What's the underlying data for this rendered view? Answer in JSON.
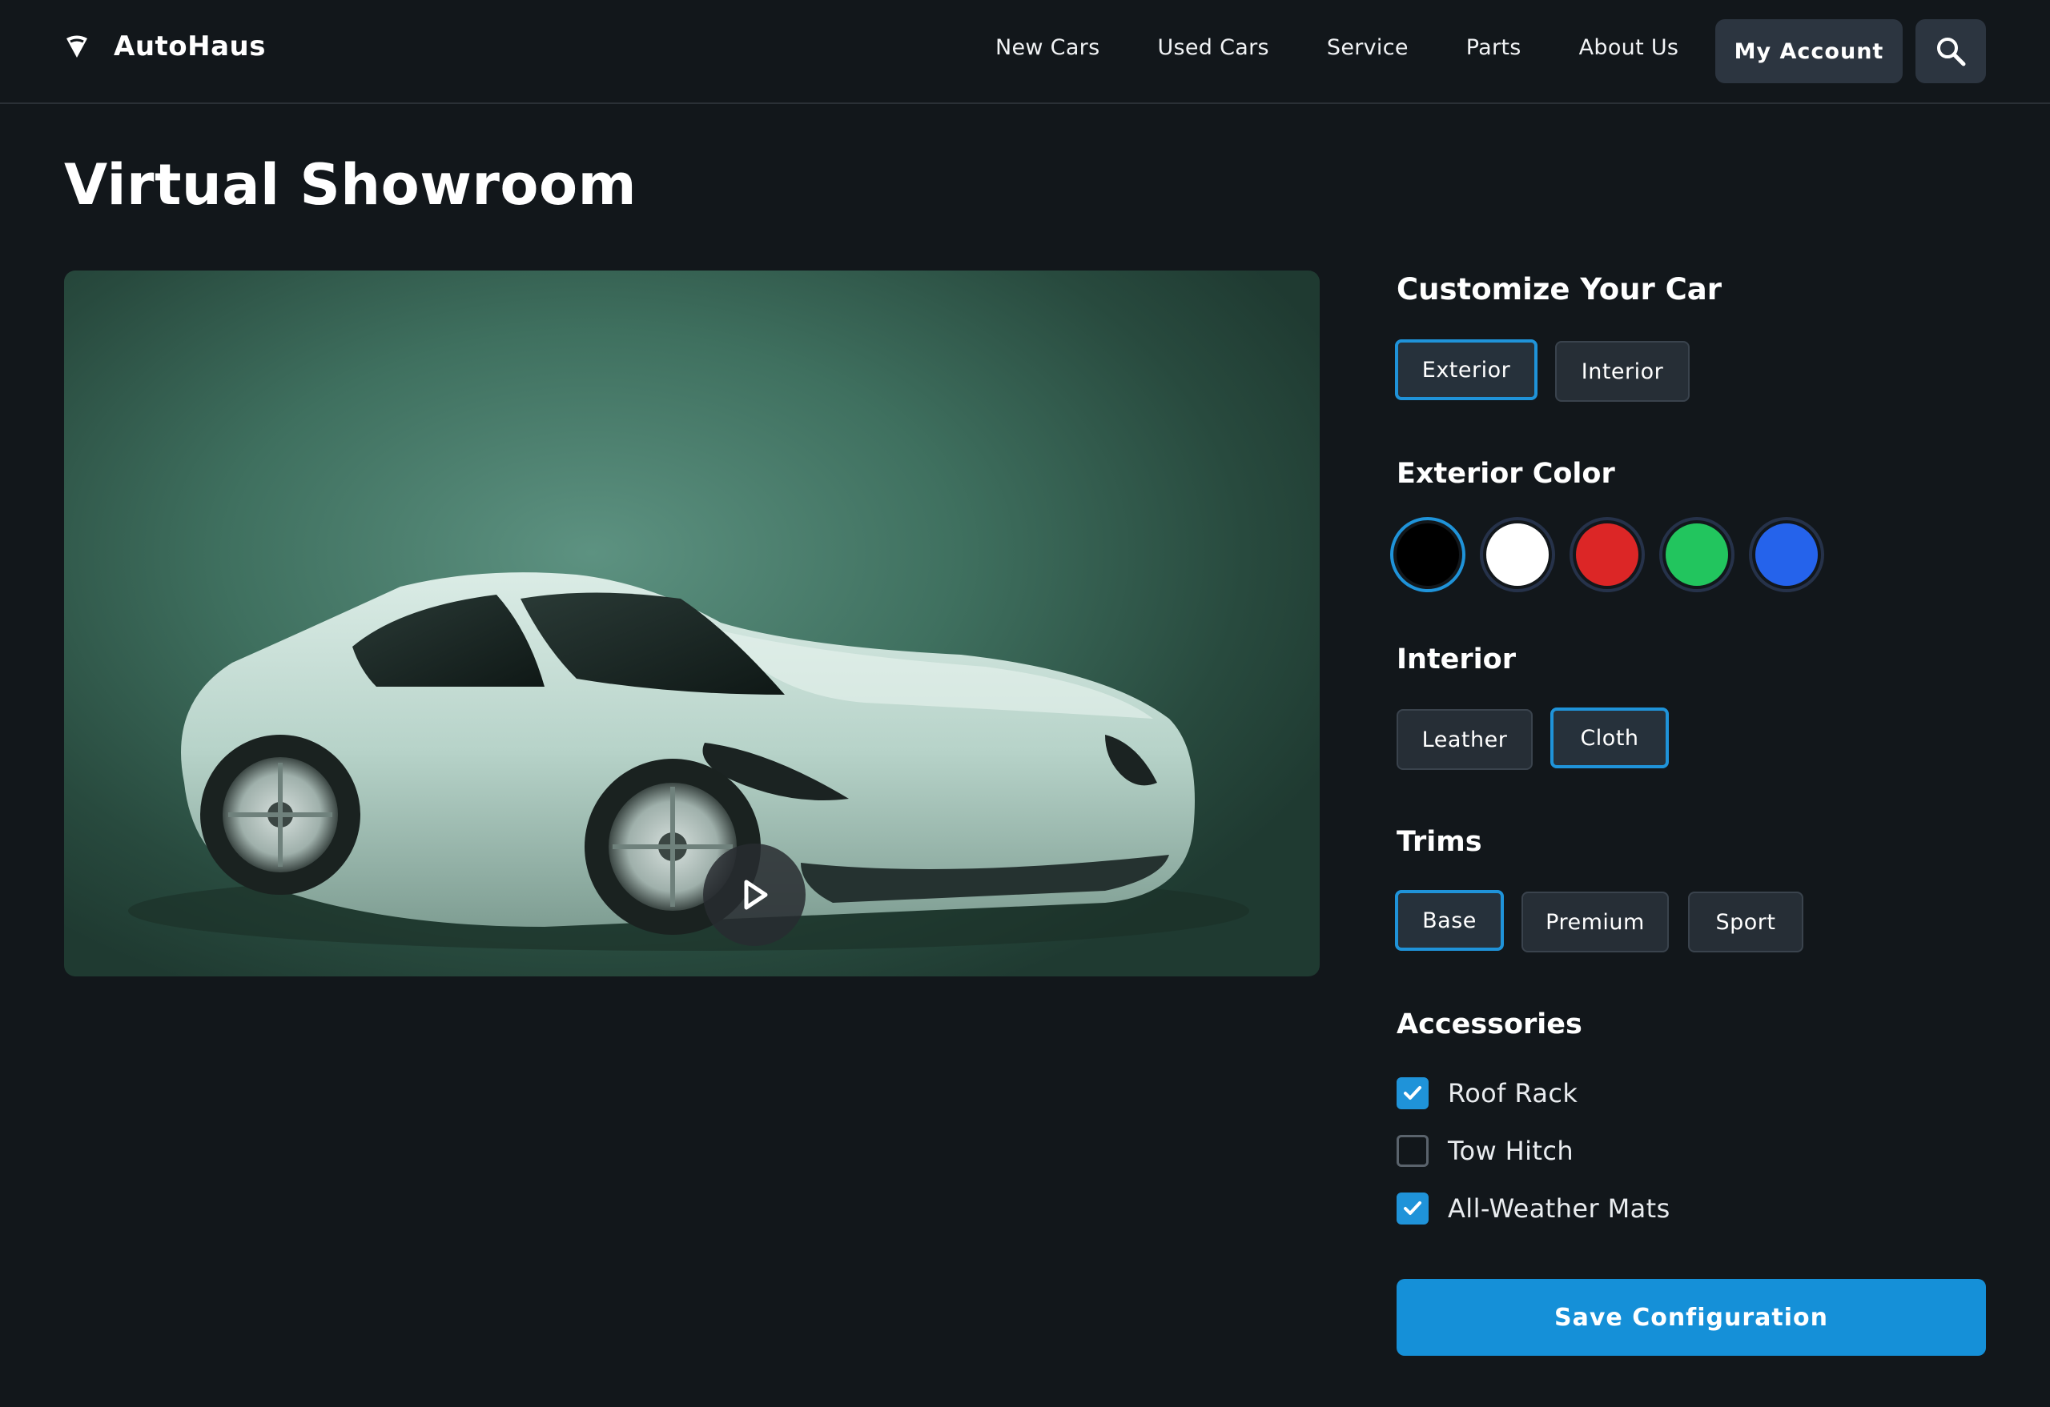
{
  "header": {
    "brand": "AutoHaus",
    "nav": [
      "New Cars",
      "Used Cars",
      "Service",
      "Parts",
      "About Us"
    ],
    "account_label": "My Account",
    "search_icon": "search-icon",
    "brand_icon": "shield-logo-icon"
  },
  "page": {
    "title": "Virtual Showroom"
  },
  "media": {
    "play_icon": "play-icon"
  },
  "customize": {
    "heading": "Customize Your Car",
    "tabs": [
      {
        "label": "Exterior",
        "selected": true
      },
      {
        "label": "Interior",
        "selected": false
      }
    ],
    "exterior_color": {
      "heading": "Exterior Color",
      "swatches": [
        {
          "color": "#000000",
          "selected": true
        },
        {
          "color": "#ffffff",
          "selected": false
        },
        {
          "color": "#dc2626",
          "selected": false
        },
        {
          "color": "#22c55e",
          "selected": false
        },
        {
          "color": "#2563eb",
          "selected": false
        }
      ]
    },
    "interior": {
      "heading": "Interior",
      "options": [
        {
          "label": "Leather",
          "selected": false
        },
        {
          "label": "Cloth",
          "selected": true
        }
      ]
    },
    "trims": {
      "heading": "Trims",
      "options": [
        {
          "label": "Base",
          "selected": true
        },
        {
          "label": "Premium",
          "selected": false
        },
        {
          "label": "Sport",
          "selected": false
        }
      ]
    },
    "accessories": {
      "heading": "Accessories",
      "items": [
        {
          "label": "Roof Rack",
          "checked": true
        },
        {
          "label": "Tow Hitch",
          "checked": false
        },
        {
          "label": "All-Weather Mats",
          "checked": true
        }
      ]
    },
    "save_label": "Save Configuration"
  },
  "colors": {
    "accent": "#1f93d9",
    "background": "#12171b",
    "button_bg": "#262e36"
  }
}
